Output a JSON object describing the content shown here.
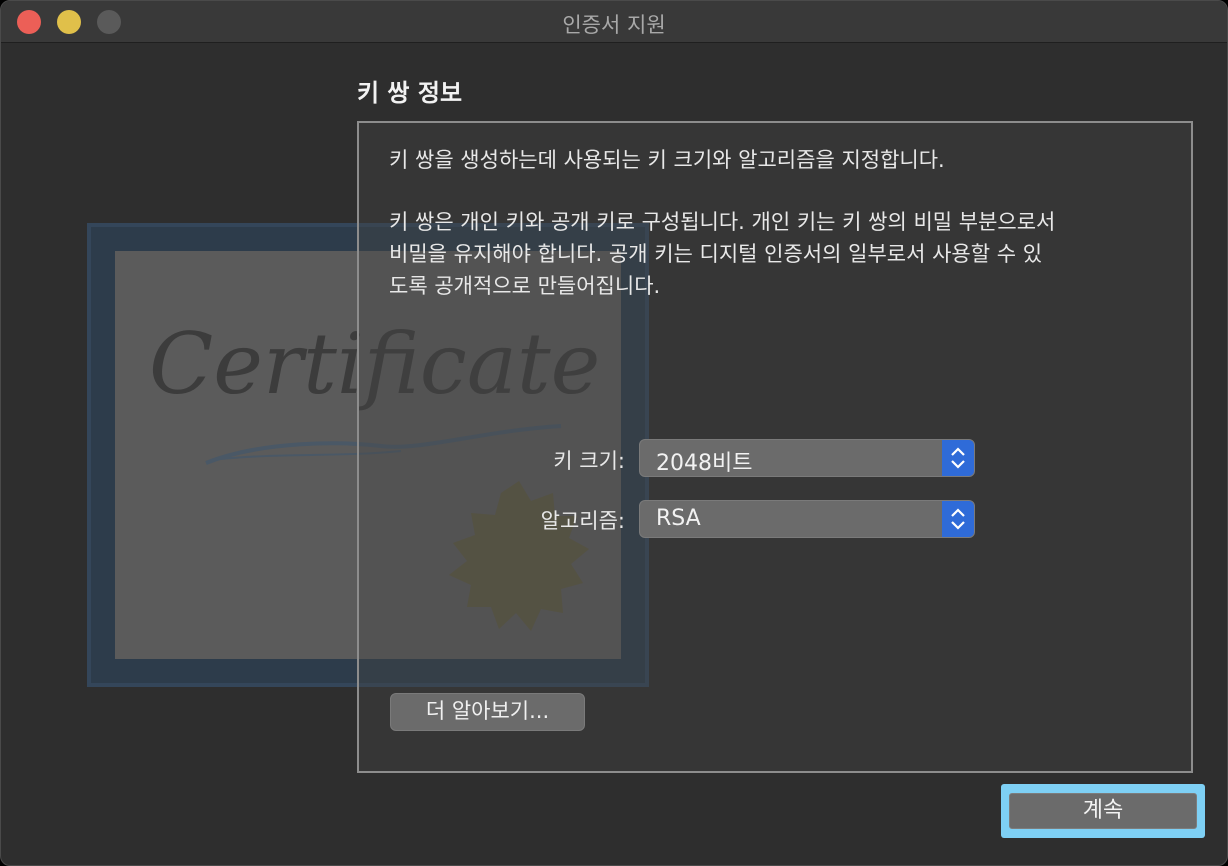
{
  "window": {
    "title": "인증서 지원"
  },
  "section": {
    "title": "키 쌍 정보",
    "paragraph1": "키 쌍을 생성하는데 사용되는 키 크기와 알고리즘을 지정합니다.",
    "paragraph2": "키 쌍은 개인 키와 공개 키로 구성됩니다. 개인 키는 키 쌍의 비밀 부분으로서\n비밀을 유지해야 합니다. 공개 키는 디지털 인증서의 일부로서 사용할 수 있\n도록 공개적으로 만들어집니다."
  },
  "fields": {
    "key_size_label": "키 크기:",
    "key_size_value": "2048비트",
    "algorithm_label": "알고리즘:",
    "algorithm_value": "RSA"
  },
  "buttons": {
    "learn_more": "더 알아보기...",
    "continue": "계속"
  },
  "illustration": {
    "certificate_text": "Certificate"
  },
  "colors": {
    "accent": "#2f6bd8",
    "focus_ring": "#7ed0f5",
    "close": "#ec5f57",
    "minimize": "#e0c04a",
    "zoom_inactive": "#5a5a5a"
  }
}
